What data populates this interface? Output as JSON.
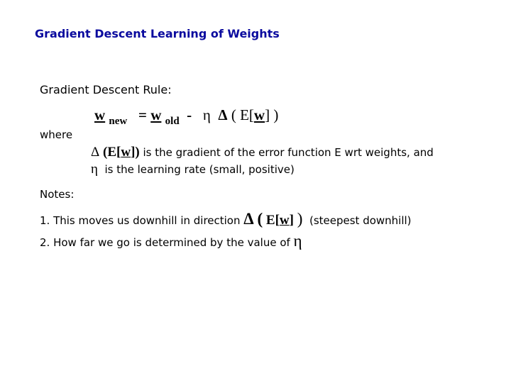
{
  "title": "Gradient Descent Learning of Weights",
  "rule_heading": "Gradient Descent Rule:",
  "equation": {
    "w_new_var": "w",
    "w_new_sub": "new",
    "equals": "=",
    "w_old_var": "w",
    "w_old_sub": "old",
    "minus": "-",
    "eta": "η",
    "delta": "Δ",
    "open": "(",
    "E_open": "E[",
    "w_in": "w",
    "E_close": "]",
    "close": ")"
  },
  "where_label": "where",
  "definitions": [
    {
      "delta": "Δ",
      "expr_open": "(E[",
      "expr_w": "w",
      "expr_close": "])",
      "text": " is the gradient of the error function E wrt weights, and"
    },
    {
      "eta": "η",
      "text": "  is the learning rate (small, positive)"
    }
  ],
  "notes_label": "Notes:",
  "notes": [
    {
      "prefix": "1. This moves us downhill in direction ",
      "delta": "Δ",
      "expr_open": "(",
      "E_open": "E[",
      "w": "w",
      "E_close": "]",
      "expr_close": ")",
      "suffix": "  (steepest downhill)"
    },
    {
      "prefix": "2. How far we go is determined by the value of ",
      "eta": "η"
    }
  ],
  "colors": {
    "title": "#0a0a9e",
    "text": "#000000",
    "background": "#ffffff"
  }
}
